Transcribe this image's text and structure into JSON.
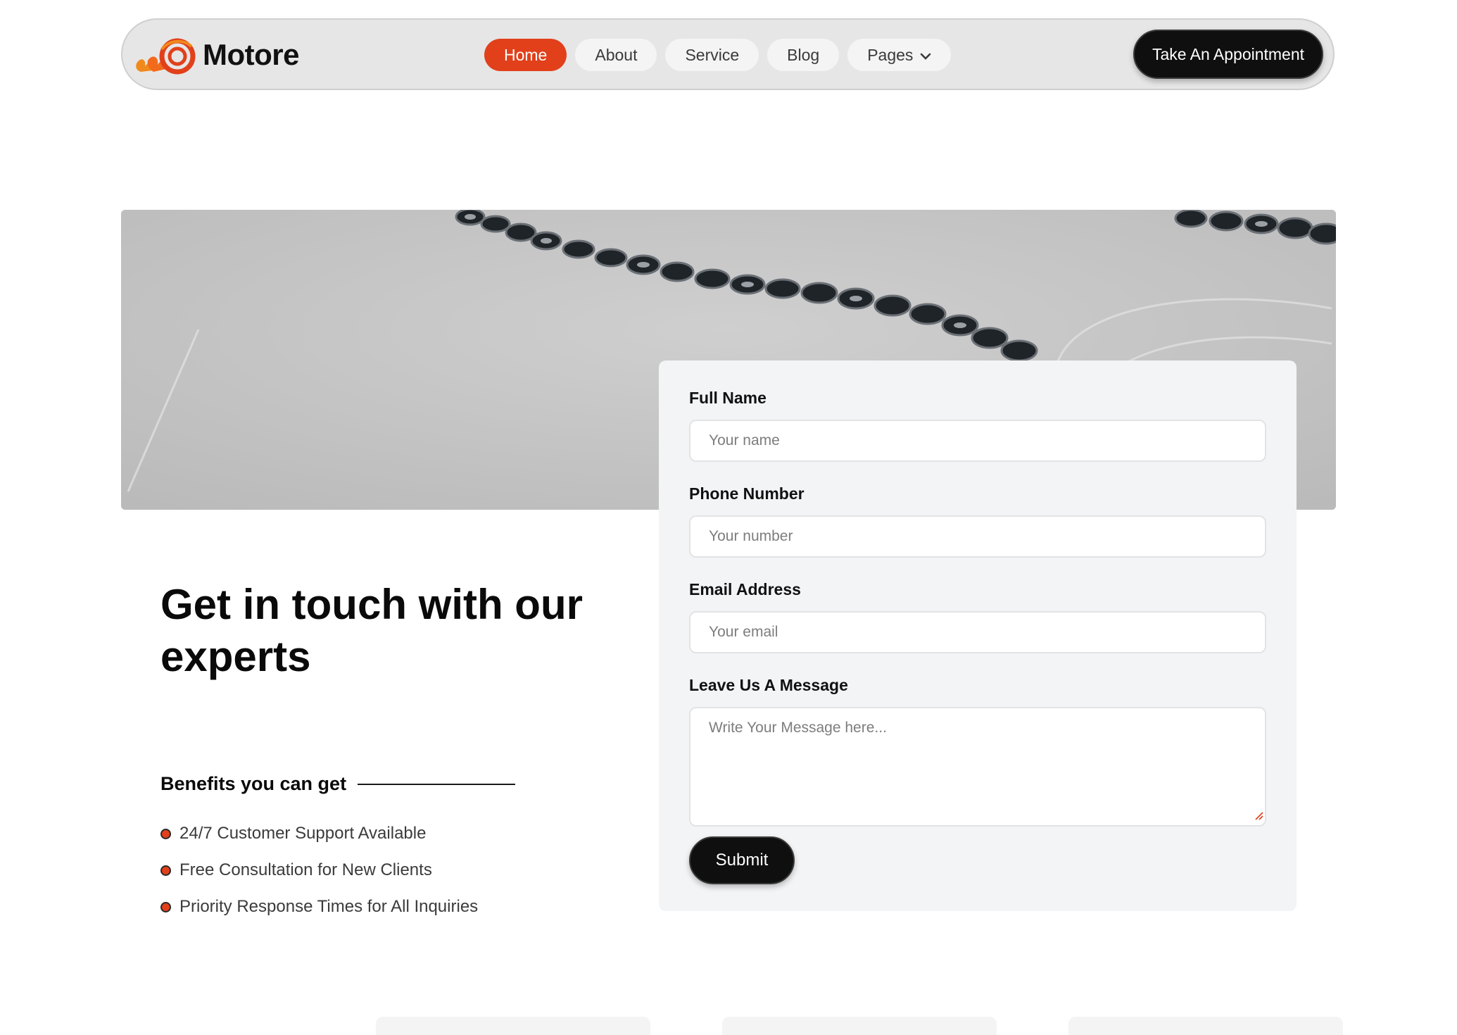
{
  "brand": {
    "name": "Motore"
  },
  "nav": {
    "items": [
      {
        "label": "Home",
        "active": true
      },
      {
        "label": "About",
        "active": false
      },
      {
        "label": "Service",
        "active": false
      },
      {
        "label": "Blog",
        "active": false
      },
      {
        "label": "Pages",
        "active": false,
        "has_dropdown": true
      }
    ],
    "cta_label": "Take An Appointment"
  },
  "hero": {
    "image": "go-kart-track-tires-photo"
  },
  "contact": {
    "headline": "Get in touch with our experts",
    "benefits_title": "Benefits you can get",
    "benefits": [
      "24/7 Customer Support Available",
      "Free Consultation for New Clients",
      "Priority Response Times for All Inquiries"
    ]
  },
  "form": {
    "name_label": "Full Name",
    "name_placeholder": "Your name",
    "phone_label": "Phone Number",
    "phone_placeholder": "Your number",
    "email_label": "Email Address",
    "email_placeholder": "Your email",
    "message_label": "Leave Us A Message",
    "message_placeholder": "Write Your Message here...",
    "submit_label": "Submit"
  },
  "colors": {
    "accent": "#e1401b",
    "dark": "#0f0f0f",
    "form_bg": "#f3f4f6"
  }
}
